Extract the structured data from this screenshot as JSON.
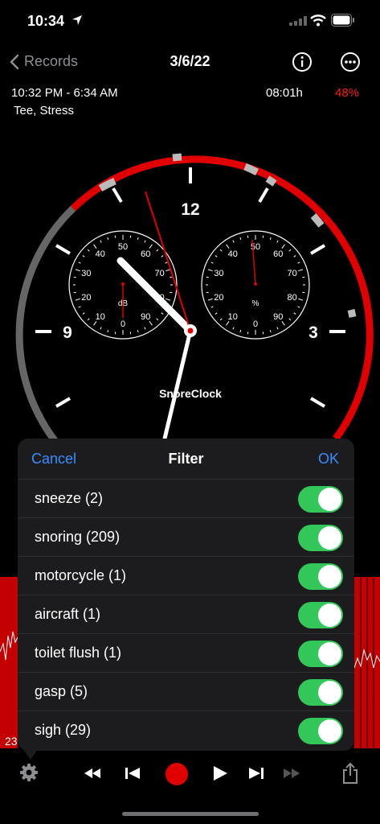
{
  "status_bar": {
    "time": "10:34"
  },
  "nav": {
    "back_label": "Records",
    "title": "3/6/22"
  },
  "session": {
    "time_range": "10:32 PM - 6:34 AM",
    "duration": "08:01h",
    "score": "48%",
    "tags": "Tee, Stress"
  },
  "gauge": {
    "numeral_12": "12",
    "numeral_3": "3",
    "numeral_9": "9",
    "brand": "SnoreClock",
    "db_dial": {
      "unit": "dB",
      "ticks": [
        "0",
        "10",
        "20",
        "30",
        "40",
        "50",
        "60",
        "70",
        "80",
        "90"
      ]
    },
    "pct_dial": {
      "unit": "%",
      "ticks": [
        "0",
        "10",
        "20",
        "30",
        "40",
        "50",
        "60",
        "70",
        "80",
        "90"
      ]
    }
  },
  "chart": {
    "left_axis_label": "23"
  },
  "filter_sheet": {
    "cancel_label": "Cancel",
    "title": "Filter",
    "ok_label": "OK",
    "items": [
      {
        "label": "sneeze (2)",
        "on": true
      },
      {
        "label": "snoring (209)",
        "on": true
      },
      {
        "label": "motorcycle (1)",
        "on": true
      },
      {
        "label": "aircraft (1)",
        "on": true
      },
      {
        "label": "toilet flush (1)",
        "on": true
      },
      {
        "label": "gasp (5)",
        "on": true
      },
      {
        "label": "sigh (29)",
        "on": true
      }
    ]
  },
  "colors": {
    "accent": "#3a8cff",
    "toggle_on": "#33c759",
    "alert_red": "#ff1a1a",
    "record_red": "#e00000"
  }
}
